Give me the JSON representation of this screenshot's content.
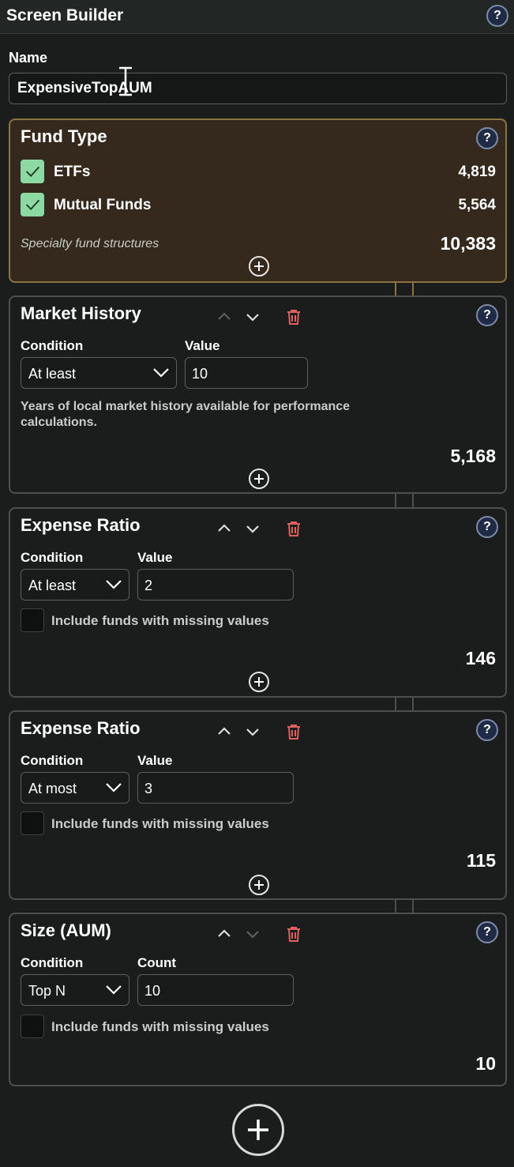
{
  "header": {
    "title": "Screen Builder",
    "help": "?"
  },
  "name": {
    "label": "Name",
    "value": "ExpensiveTopAUM"
  },
  "fund_type": {
    "title": "Fund Type",
    "help": "?",
    "items": [
      {
        "label": "ETFs",
        "count": "4,819",
        "checked": true
      },
      {
        "label": "Mutual Funds",
        "count": "5,564",
        "checked": true
      }
    ],
    "note": "Specialty fund structures",
    "total": "10,383"
  },
  "filters": [
    {
      "title": "Market History",
      "help": "?",
      "condition_label": "Condition",
      "condition": "At least",
      "value_label": "Value",
      "value": "10",
      "description": "Years of local market history available for performance calculations.",
      "count": "5,168"
    },
    {
      "title": "Expense Ratio",
      "help": "?",
      "condition_label": "Condition",
      "condition": "At least",
      "value_label": "Value",
      "value": "2",
      "missing_label": "Include funds with missing values",
      "count": "146"
    },
    {
      "title": "Expense Ratio",
      "help": "?",
      "condition_label": "Condition",
      "condition": "At most",
      "value_label": "Value",
      "value": "3",
      "missing_label": "Include funds with missing values",
      "count": "115"
    },
    {
      "title": "Size (AUM)",
      "help": "?",
      "condition_label": "Condition",
      "condition": "Top N",
      "value_label": "Count",
      "value": "10",
      "missing_label": "Include funds with missing values",
      "count": "10"
    }
  ],
  "colors": {
    "background": "#1b1d1c",
    "fund_type_border": "#8c7440",
    "fund_type_bg": "#34291c",
    "checkbox_checked": "#8cd9a4",
    "trash": "#e06060",
    "help_bg": "#1f2a45"
  },
  "icons": {
    "help": "question-circle-icon",
    "move_up": "chevron-up-icon",
    "move_down": "chevron-down-icon",
    "delete": "trash-icon",
    "add": "plus-circle-icon",
    "check": "checkmark-icon"
  }
}
